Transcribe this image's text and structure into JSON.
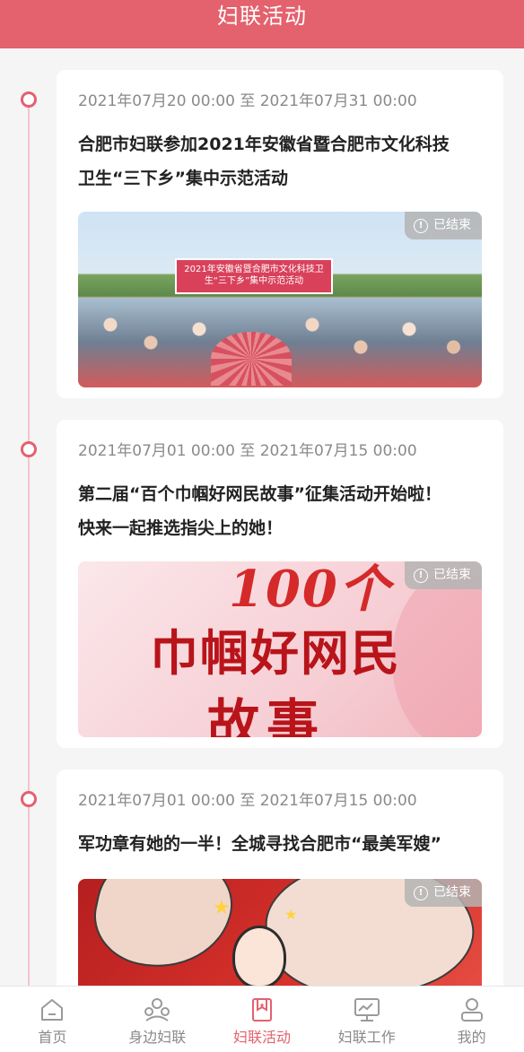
{
  "header": {
    "title": "妇联活动"
  },
  "activities": [
    {
      "date_range": "2021年07月20 00:00 至 2021年07月31 00:00",
      "title_line1": "合肥市妇联参加2021年安徽省暨合肥市文化科技",
      "title_line2": "卫生“三下乡”集中示范活动",
      "status": "已结束",
      "image_banner": "2021年安徽省暨合肥市文化科技卫生“三下乡”集中示范活动"
    },
    {
      "date_range": "2021年07月01 00:00 至 2021年07月15 00:00",
      "title_line1": "第二届“百个巾帼好网民故事”征集活动开始啦！",
      "title_line2": "快来一起推选指尖上的她！",
      "status": "已结束",
      "poster_line1": "100个",
      "poster_line2": "巾帼好网民",
      "poster_line3": "故事"
    },
    {
      "date_range": "2021年07月01 00:00 至 2021年07月15 00:00",
      "title_line1": "军功章有她的一半！全城寻找合肥市“最美军嫂”",
      "status": "已结束"
    }
  ],
  "tabbar": [
    {
      "label": "首页",
      "icon": "home-icon",
      "active": false
    },
    {
      "label": "身边妇联",
      "icon": "people-icon",
      "active": false
    },
    {
      "label": "妇联活动",
      "icon": "flag-icon",
      "active": true
    },
    {
      "label": "妇联工作",
      "icon": "monitor-icon",
      "active": false
    },
    {
      "label": "我的",
      "icon": "user-icon",
      "active": false
    }
  ],
  "colors": {
    "accent": "#e4616e",
    "timeline": "#f2c6cc",
    "text_gray": "#8a8a8a"
  }
}
